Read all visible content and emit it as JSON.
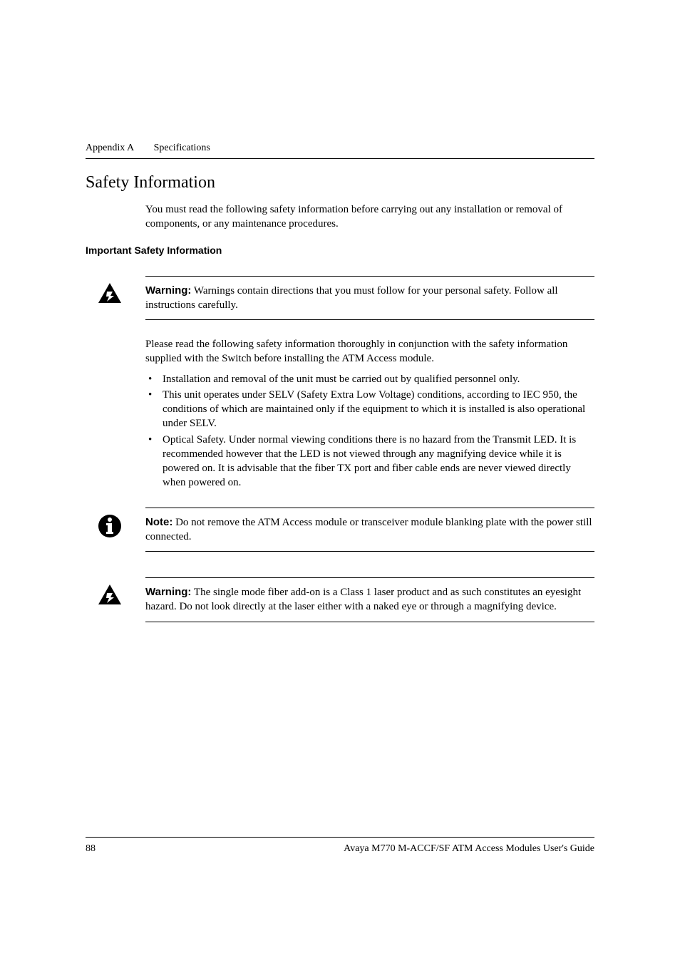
{
  "header": {
    "appendix": "Appendix A",
    "title": "Specifications"
  },
  "section_title": "Safety Information",
  "intro_text": "You must read the following safety information before carrying out any installation or removal of components, or any maintenance procedures.",
  "subsection_heading": "Important Safety Information",
  "warning1": {
    "label": "Warning:",
    "text": "Warnings contain directions that you must follow for your personal safety. Follow all instructions carefully."
  },
  "safety_body": "Please read the following safety information thoroughly in conjunction with the safety information supplied with the Switch before installing the ATM Access module.",
  "bullets": [
    "Installation and removal of the unit must be carried out by qualified personnel only.",
    "This unit operates under SELV (Safety Extra Low Voltage) conditions, according to IEC 950, the conditions of which are maintained only if the equipment to which it is installed is also operational under SELV.",
    "Optical Safety. Under normal viewing conditions there is no hazard from the Transmit LED. It is recommended however that the LED is not viewed through any magnifying device while it is powered on. It is advisable that the fiber TX port and fiber cable ends are never viewed directly when powered on."
  ],
  "note": {
    "label": "Note:",
    "text": "Do not remove the ATM Access module or transceiver module blanking plate with the power still connected."
  },
  "warning2": {
    "label": "Warning:",
    "text": "The single mode fiber add-on is a Class 1 laser product and as such constitutes an eyesight hazard. Do not look directly at the laser either with a naked eye or through a magnifying device."
  },
  "footer": {
    "page": "88",
    "text": "Avaya M770 M-ACCF/SF ATM Access Modules User's Guide"
  }
}
